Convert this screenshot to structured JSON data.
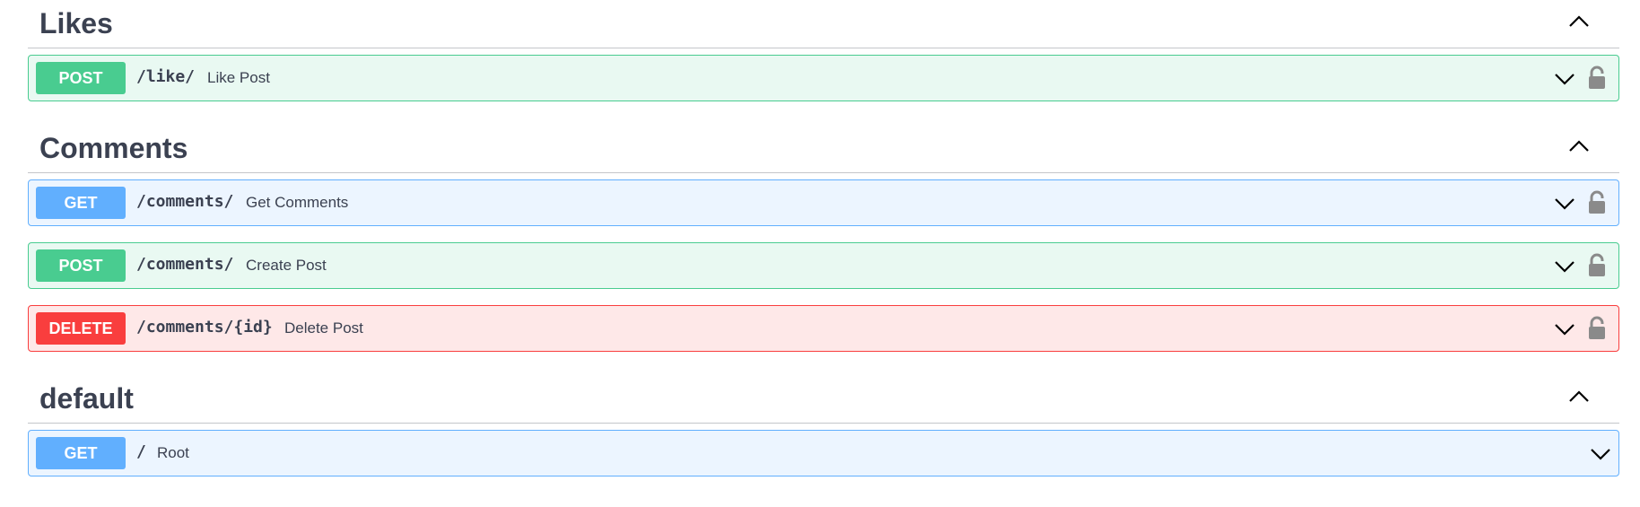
{
  "sections": [
    {
      "title": "Likes",
      "operations": [
        {
          "method": "POST",
          "path": "/like/",
          "summary": "Like Post"
        }
      ]
    },
    {
      "title": "Comments",
      "operations": [
        {
          "method": "GET",
          "path": "/comments/",
          "summary": "Get Comments"
        },
        {
          "method": "POST",
          "path": "/comments/",
          "summary": "Create Post"
        },
        {
          "method": "DELETE",
          "path": "/comments/{id}",
          "summary": "Delete Post"
        }
      ]
    },
    {
      "title": "default",
      "operations": [
        {
          "method": "GET",
          "path": "/",
          "summary": "Root"
        }
      ]
    }
  ],
  "colors": {
    "post": "#49cc90",
    "get": "#61affe",
    "delete": "#f93e3e",
    "text": "#3b4151"
  },
  "icons": {
    "collapse": "chevron-up-icon",
    "expand": "chevron-down-icon",
    "auth": "lock-icon"
  }
}
